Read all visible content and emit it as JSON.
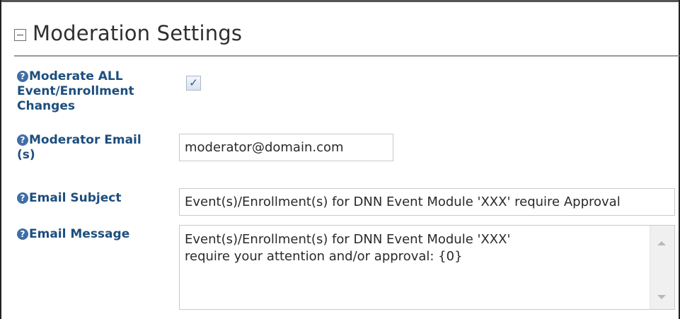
{
  "section": {
    "title": "Moderation Settings",
    "collapse_icon": "minus-box-icon"
  },
  "help_icon": {
    "glyph": "?",
    "name": "help-circle-icon",
    "color": "#3f6ea8"
  },
  "fields": {
    "moderate_all": {
      "label_line1": "Moderate ALL",
      "label_line2": "Event/Enrollment",
      "label_line3": "Changes",
      "checked": true,
      "check_glyph": "✓"
    },
    "moderator_email": {
      "label_line1": "Moderator Email",
      "label_line2": "(s)",
      "value": "moderator@domain.com"
    },
    "email_subject": {
      "label": "Email Subject",
      "value": "Event(s)/Enrollment(s) for DNN Event Module 'XXX' require Approval"
    },
    "email_message": {
      "label": "Email Message",
      "value": "Event(s)/Enrollment(s) for DNN Event Module 'XXX'\nrequire your attention and/or approval: {0}"
    }
  },
  "colors": {
    "label": "#1d4e7e",
    "title": "#2f2f2f",
    "rule": "#9a9a9a"
  }
}
